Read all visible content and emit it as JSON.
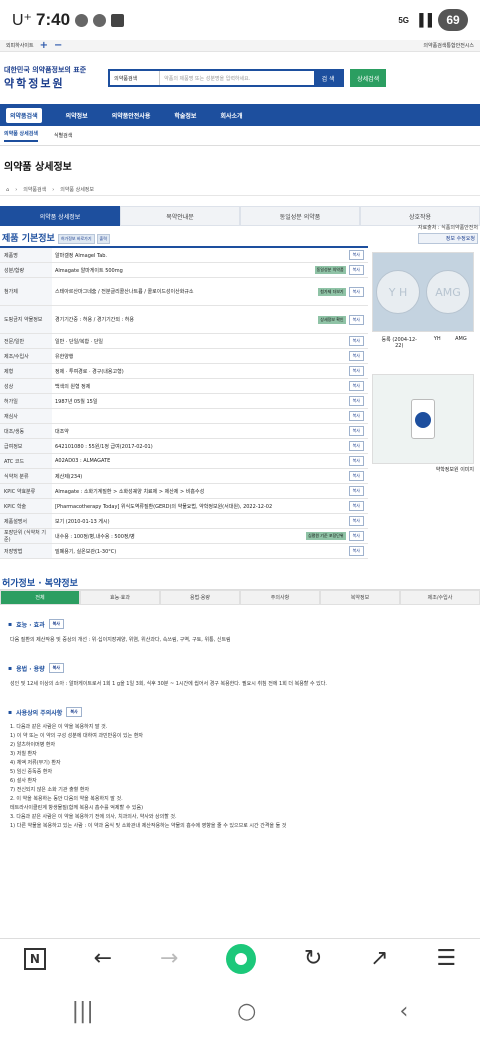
{
  "status": {
    "carrier": "U⁺",
    "time": "7:40",
    "talk": "TALK",
    "signal": "5G",
    "battery": "69"
  },
  "util": {
    "left": "외피하사이트",
    "right": "의약품검색통합안전시스"
  },
  "header": {
    "logo_line1": "대한민국 의약품정보의 표준",
    "logo_line2": "약학정보원",
    "search_select": "의약품검색",
    "search_placeholder": "약품의 제품명 또는 성분명을 입력하세요.",
    "search_btn": "검 색",
    "combo_btn": "상세검색"
  },
  "gnb": [
    "의약품검색",
    "의약정보",
    "의약품안전사용",
    "학술정보",
    "회사소개"
  ],
  "subnav": [
    "의약품 상세검색",
    "식별검색"
  ],
  "page_title": "의약품 상세정보",
  "breadcrumb": [
    "의약품검색",
    "의약품 상세정보"
  ],
  "tabs": [
    "의약품 상세정보",
    "복약안내문",
    "동일성분 의약품",
    "상호작용"
  ],
  "section1": {
    "title": "제품 기본정보",
    "btn1": "허가정보 바로가기",
    "btn2": "출력",
    "src": "자료출처 : 식품의약품안전처",
    "src_btn": "정보 수정요청"
  },
  "rows": [
    {
      "k": "제품명",
      "v": "알마겔정 Almagel Tab."
    },
    {
      "k": "성분/함량",
      "v": "Almagate 알마게이트 500mg",
      "tag": "동일성분 의약품"
    },
    {
      "k": "첨가제",
      "v": "스테아르산마그네슘 / 전분글리콜산나트륨 / 콜로이드성이산화규소",
      "tag": "첨가제 더보기"
    },
    {
      "k": "도핑금지 약물정보",
      "v": "경기기간중 : 허용 / 경기기간외 : 허용",
      "tag": "상세정보 확인"
    },
    {
      "k": "전문/일반",
      "v": "일반 · 단일/복합 · 단일"
    },
    {
      "k": "제조/수입사",
      "v": "유한양행"
    },
    {
      "k": "제형",
      "v": "정제 · 투여경로 · 경구(내용고형)"
    },
    {
      "k": "성상",
      "v": "백색의 원형 정제"
    },
    {
      "k": "허가일",
      "v": "1987년 05월 15일"
    },
    {
      "k": "재심사",
      "v": ""
    },
    {
      "k": "대조/생동",
      "v": "대조약"
    },
    {
      "k": "급여정보",
      "v": "642101080 : 55원/1정 급여(2017-02-01)"
    },
    {
      "k": "ATC 코드",
      "v": "A02AD03 : ALMAGATE"
    },
    {
      "k": "식약처 분류",
      "v": "제산제(234)"
    },
    {
      "k": "KPIC 약효분류",
      "v": "Almagate : 소화기계질환 > 소화성궤양 치료제 > 제산제 > 비흡수성"
    },
    {
      "k": "KPIC 학술",
      "v": "[Pharmacotherapy Today] 위식도역류질환(GERD)의 약물요법, 약학정보원(서대원), 2022-12-02"
    },
    {
      "k": "제품설명서",
      "v": "보기 (2010-01-13 게시)"
    },
    {
      "k": "포장단위 (식약처 기준)",
      "v": "내수용 : 100정/병,내수용 : 500정/병",
      "tag": "심평원 기준 포장단위"
    },
    {
      "k": "저장방법",
      "v": "밀폐용기, 실온보관(1-30°C)"
    }
  ],
  "copy_label": "복사",
  "pill": {
    "mark1": "Y H",
    "mark2": "AMG",
    "date": "등록 (2004-12-22)",
    "front": "YH",
    "back": "AMG",
    "more": "약학정보원 이미지"
  },
  "section2": {
    "title": "허가정보 · 복약정보"
  },
  "tabs2": [
    "전체",
    "효능·효과",
    "용법·용량",
    "주의사항",
    "복약정보",
    "제조/수입사"
  ],
  "efficacy": {
    "title": "효능 · 효과",
    "text": "다음 질환의 제산작용 및 증상의 개선 : 위·십이지장궤양, 위염, 위산과다, 속쓰림, 구역, 구토, 위통, 신트림"
  },
  "dosage": {
    "title": "용법 · 용량",
    "text": "성인 및 12세 이상의 소아 : 알마게이트로서 1회 1 g을 1일 3회, 식후 30분 ~ 1시간에 씹어서 경구 복용한다. 필요시 취침 전에 1회 더 복용할 수 있다."
  },
  "caution": {
    "title": "사용상의 주의사항",
    "lines": [
      "1. 다음과 같은 사람은 이 약을 복용하지 말 것.",
      "1) 이 약 또는 이 약의 구성 성분에 대하여 과민반응이 있는 환자",
      "2) 알츠하이머병 환자",
      "3) 저칠 환자",
      "4) 체액 저류(부기) 환자",
      "5) 임신 중독증 환자",
      "6) 설사 환자",
      "7) 전신되지 않은 소화 기관 출혈 환자",
      "2. 이 약을 복용하는 동안 다음의 약을 복용하지 말 것.",
      "테트라사이클린계 항생물질(함께 복용시 흡수를 억제할 수 있음)",
      "3. 다음과 같은 사람은 이 약을 복용하기 전에 의사, 치과의사, 약사와 상의할 것.",
      "1) 다른 약물을 복용하고 있는 사람 : 이 약과 음식 및 소화관내 제산작용하는 약물의 흡수에 영향을 줄 수 있으므로 시간 간격을 둘 것"
    ]
  },
  "browser": {
    "n": "N",
    "back": "←",
    "fwd": "→",
    "reload": "↻",
    "share": "↗",
    "menu": "☰"
  },
  "sys": {
    "recent": "|||",
    "home": "○",
    "back": "‹"
  }
}
